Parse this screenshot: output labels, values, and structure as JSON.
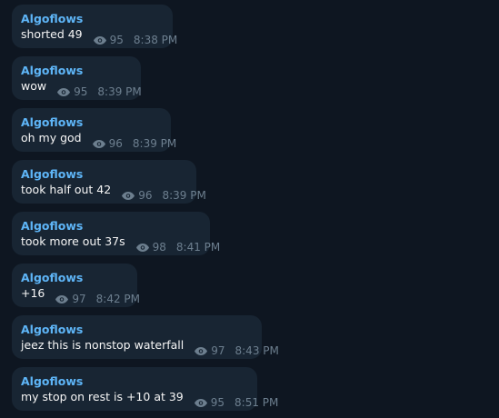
{
  "messages": [
    {
      "sender": "Algoflows",
      "text": "shorted 49",
      "views": "95",
      "time": "8:38 PM"
    },
    {
      "sender": "Algoflows",
      "text": "wow",
      "views": "95",
      "time": "8:39 PM"
    },
    {
      "sender": "Algoflows",
      "text": "oh my god",
      "views": "96",
      "time": "8:39 PM"
    },
    {
      "sender": "Algoflows",
      "text": "took half out 42",
      "views": "96",
      "time": "8:39 PM"
    },
    {
      "sender": "Algoflows",
      "text": "took more out 37s",
      "views": "98",
      "time": "8:41 PM"
    },
    {
      "sender": "Algoflows",
      "text": "+16",
      "views": "97",
      "time": "8:42 PM"
    },
    {
      "sender": "Algoflows",
      "text": "jeez this is nonstop waterfall",
      "views": "97",
      "time": "8:43 PM"
    },
    {
      "sender": "Algoflows",
      "text": "my stop on rest is +10 at 39",
      "views": "95",
      "time": "8:51 PM"
    }
  ],
  "icons": {
    "views": "eye-icon"
  },
  "colors": {
    "background": "#0e1621",
    "bubble": "#182533",
    "sender": "#5eb5f7",
    "text": "#f5f5f5",
    "meta": "#6d7f8f"
  }
}
